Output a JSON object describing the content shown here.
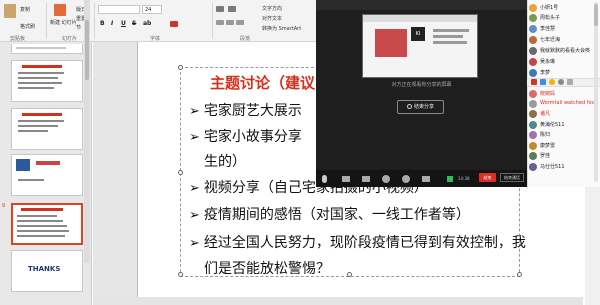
{
  "ribbon": {
    "clipboard": {
      "copy": "复制",
      "format_painter": "格式刷",
      "group": "剪贴板"
    },
    "slides": {
      "new_slide": "新建\n幻灯片",
      "layout": "版式",
      "reset": "重置",
      "section": "节",
      "group": "幻灯片"
    },
    "font": {
      "name": "",
      "size": "24",
      "group": "字体",
      "bold": "B",
      "italic": "I",
      "underline": "U",
      "strike": "S",
      "shadow": "ab"
    },
    "paragraph": {
      "group": "段落",
      "text_direction": "文字方向",
      "align_text": "对齐文本",
      "smartart": "转换为 SmartArt"
    }
  },
  "sidebar": {
    "slides": [
      {
        "num": "",
        "kind": "list"
      },
      {
        "num": "",
        "kind": "list"
      },
      {
        "num": "",
        "kind": "image"
      },
      {
        "num": "",
        "kind": "blue"
      },
      {
        "num": "9",
        "kind": "list",
        "selected": true
      },
      {
        "num": "",
        "kind": "thanks",
        "text": "THANKS"
      }
    ]
  },
  "slide": {
    "title": "主题讨论（建议3",
    "bullets": [
      "宅家厨艺大展示",
      "宅家小故事分享",
      "生的）",
      "视频分享（自己宅家拍摄的小视频）",
      "疫情期间的感悟（对国家、一线工作者等）",
      "经过全国人民努力，现阶段疫情已得到有效控制，我",
      "们是否能放松警惕？"
    ],
    "paren_fragment_1": "（",
    "paren_fragment_2": "（"
  },
  "video": {
    "caption": "对方正在观看你分享的屏幕",
    "stop_share": "结束分享",
    "time": "14:38",
    "end": "结束",
    "end_meeting": "结束通话",
    "preview_badge": "KI"
  },
  "participants": [
    {
      "name": "小妍1号",
      "color": "#e8a33b",
      "red": false
    },
    {
      "name": "周松头子",
      "color": "#7a9c4f",
      "red": false
    },
    {
      "name": "李佳慧",
      "color": "#5f8fc9",
      "red": false
    },
    {
      "name": "七年迁海",
      "color": "#b86a3c",
      "red": false
    },
    {
      "name": "我就默默的看看大会咳",
      "color": "#6b6b6b",
      "red": false
    },
    {
      "name": "吴永琳",
      "color": "#c04a4a",
      "red": false
    },
    {
      "name": "李梦",
      "color": "#3d7ab8",
      "red": false
    },
    {
      "name": "晓婉妈",
      "color": "#d96b6b",
      "red": true
    },
    {
      "name": "Wormtail watched his",
      "color": "#9a9a9a",
      "red": true
    },
    {
      "name": "诸凡",
      "color": "#8b6f47",
      "red": true
    },
    {
      "name": "黄海伦511",
      "color": "#4f8a8b",
      "red": false
    },
    {
      "name": "陈归",
      "color": "#a86fb0",
      "red": false
    },
    {
      "name": "康梦雷",
      "color": "#c48a2f",
      "red": false
    },
    {
      "name": "罗佳",
      "color": "#5a7d5a",
      "red": false
    },
    {
      "name": "马仕仕511",
      "color": "#6d5b9c",
      "red": false
    }
  ]
}
